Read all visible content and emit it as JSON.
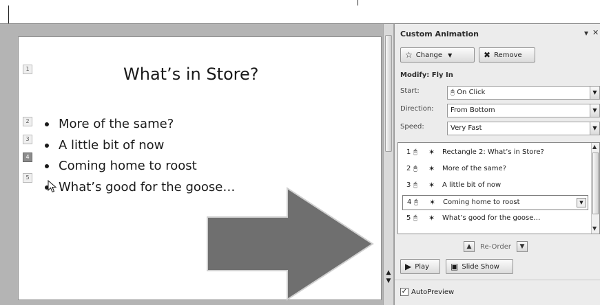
{
  "slide": {
    "title": "What’s in Store?",
    "bullets": [
      "More of the same?",
      "A little bit of now",
      "Coming home to roost",
      "What’s good for the goose…"
    ],
    "badges": [
      "1",
      "2",
      "3",
      "4",
      "5"
    ],
    "selected_badge": "4"
  },
  "task_pane": {
    "title": "Custom Animation",
    "change_label": "Change",
    "remove_label": "Remove",
    "modify_label": "Modify: Fly In",
    "start_label": "Start:",
    "start_value": "On Click",
    "direction_label": "Direction:",
    "direction_value": "From Bottom",
    "speed_label": "Speed:",
    "speed_value": "Very Fast",
    "animations": [
      {
        "index": "1",
        "name": "Rectangle 2: What’s in Store?"
      },
      {
        "index": "2",
        "name": "More of the same?"
      },
      {
        "index": "3",
        "name": "A little bit of now"
      },
      {
        "index": "4",
        "name": "Coming home to roost"
      },
      {
        "index": "5",
        "name": "What’s good for the goose…"
      }
    ],
    "selected_animation": "4",
    "reorder_label": "Re-Order",
    "play_label": "Play",
    "slideshow_label": "Slide Show",
    "autopreview_label": "AutoPreview",
    "autopreview_checked": true
  },
  "icons": {
    "cursor": "mouse-pointer-icon",
    "arrow": "right-block-arrow-shape"
  },
  "colors": {
    "slide_bg": "#ffffff",
    "workspace": "#b4b4b4",
    "pane_bg": "#ececec",
    "arrow_fill": "#6f6f6f"
  }
}
